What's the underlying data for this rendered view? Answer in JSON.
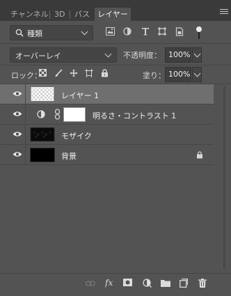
{
  "tabs": [
    {
      "label": "チャンネル"
    },
    {
      "label": "3D"
    },
    {
      "label": "パス"
    },
    {
      "label": "レイヤー"
    }
  ],
  "filter": {
    "kind_label": "種類"
  },
  "blend_mode": "オーバーレイ",
  "opacity": {
    "label": "不透明度：",
    "value": "100%"
  },
  "lock": {
    "label": "ロック："
  },
  "fill": {
    "label": "塗り：",
    "value": "100%"
  },
  "layers": [
    {
      "name": "レイヤー 1",
      "selected": true
    },
    {
      "name": "明るさ・コントラスト 1",
      "selected": false
    },
    {
      "name": "モザイク",
      "selected": false
    },
    {
      "name": "背景",
      "selected": false,
      "locked": true
    }
  ],
  "bottom_icons": [
    "link-icon",
    "fx-icon",
    "mask-icon",
    "adjustment-icon",
    "folder-icon",
    "new-layer-icon",
    "trash-icon"
  ]
}
